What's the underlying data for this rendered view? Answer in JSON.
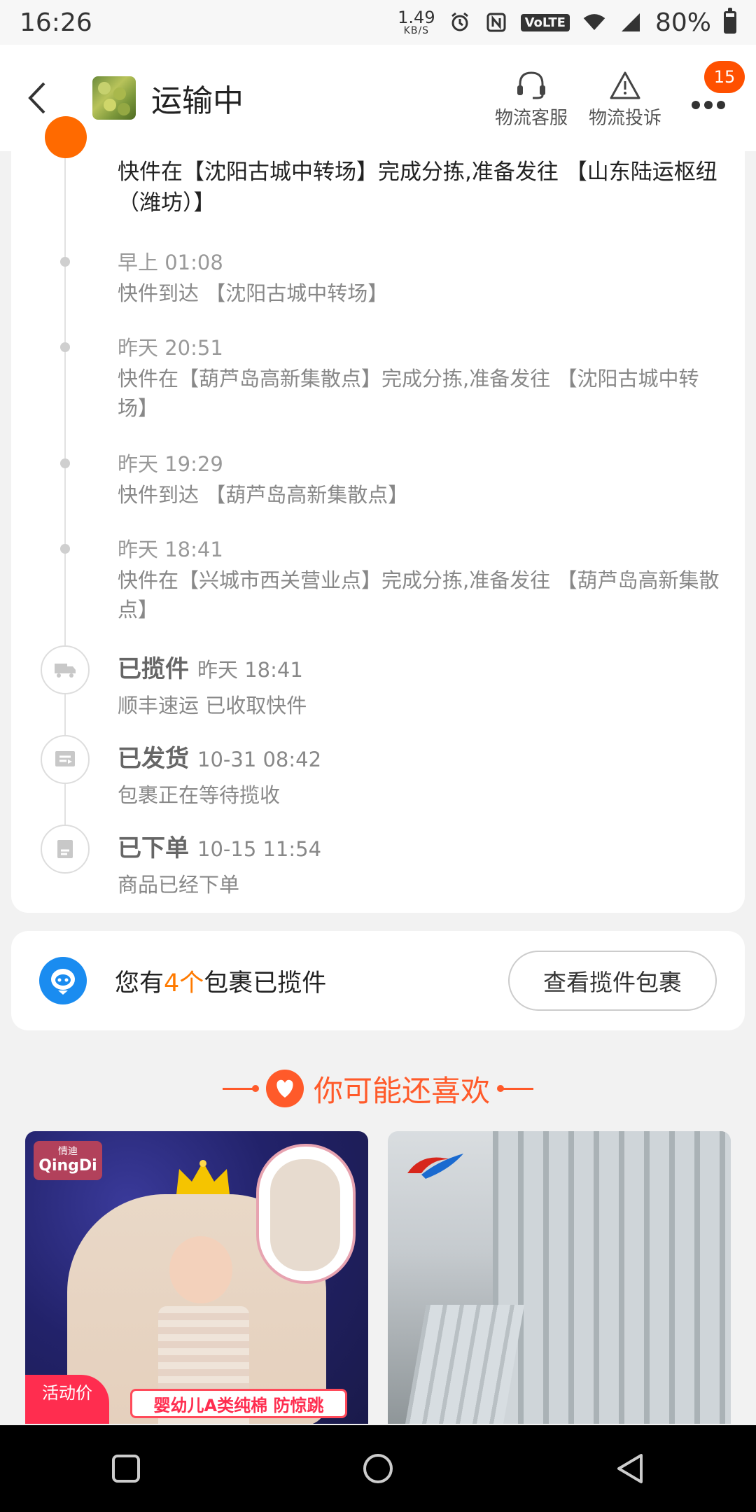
{
  "status_bar": {
    "time": "16:26",
    "net_speed": "1.49",
    "net_unit": "KB/S",
    "volte": "VoLTE",
    "battery": "80%",
    "battery_level": 0.8
  },
  "header": {
    "title": "运输中",
    "actions": [
      {
        "label": "物流客服",
        "icon": "headset-icon"
      },
      {
        "label": "物流投诉",
        "icon": "warning-icon"
      }
    ],
    "badge": "15"
  },
  "timeline": {
    "current": {
      "desc": "快件在【沈阳古城中转场】完成分拣,准备发往 【山东陆运枢纽（潍坊）】"
    },
    "events": [
      {
        "time": "早上 01:08",
        "desc": "快件到达 【沈阳古城中转场】"
      },
      {
        "time": "昨天 20:51",
        "desc": "快件在【葫芦岛高新集散点】完成分拣,准备发往 【沈阳古城中转场】"
      },
      {
        "time": "昨天 19:29",
        "desc": "快件到达 【葫芦岛高新集散点】"
      },
      {
        "time": "昨天 18:41",
        "desc": "快件在【兴城市西关营业点】完成分拣,准备发往 【葫芦岛高新集散点】"
      }
    ],
    "statuses": [
      {
        "title": "已揽件",
        "time": "昨天 18:41",
        "desc": "顺丰速运 已收取快件",
        "icon": "truck-icon"
      },
      {
        "title": "已发货",
        "time": "10-31 08:42",
        "desc": "包裹正在等待揽收",
        "icon": "shipped-box-icon"
      },
      {
        "title": "已下单",
        "time": "10-15 11:54",
        "desc": "商品已经下单",
        "icon": "order-document-icon"
      }
    ]
  },
  "pickup": {
    "prefix": "您有",
    "count": "4个",
    "suffix": "包裹已揽件",
    "button": "查看揽件包裹"
  },
  "recommend": {
    "title": "你可能还喜欢",
    "products": [
      {
        "brand_cn": "情迪",
        "brand_en": "QingDi",
        "price_label": "活动价",
        "caption": "婴幼儿A类纯棉 防惊跳"
      },
      {
        "caption": ""
      }
    ]
  },
  "colors": {
    "accent": "#ff5000",
    "recommend": "#ff5a2a",
    "pickup_count": "#ff7a00",
    "pickup_icon": "#1a8cf0"
  }
}
